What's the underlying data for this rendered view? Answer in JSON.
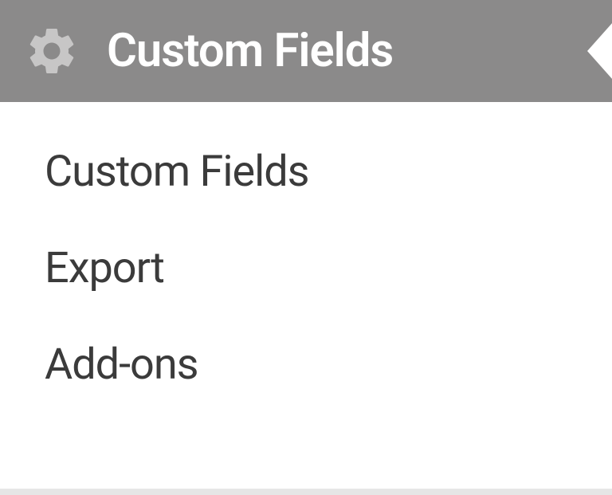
{
  "menu": {
    "header": {
      "label": "Custom Fields",
      "icon": "gear-icon"
    },
    "submenu": {
      "items": [
        {
          "label": "Custom Fields"
        },
        {
          "label": "Export"
        },
        {
          "label": "Add-ons"
        }
      ]
    }
  }
}
